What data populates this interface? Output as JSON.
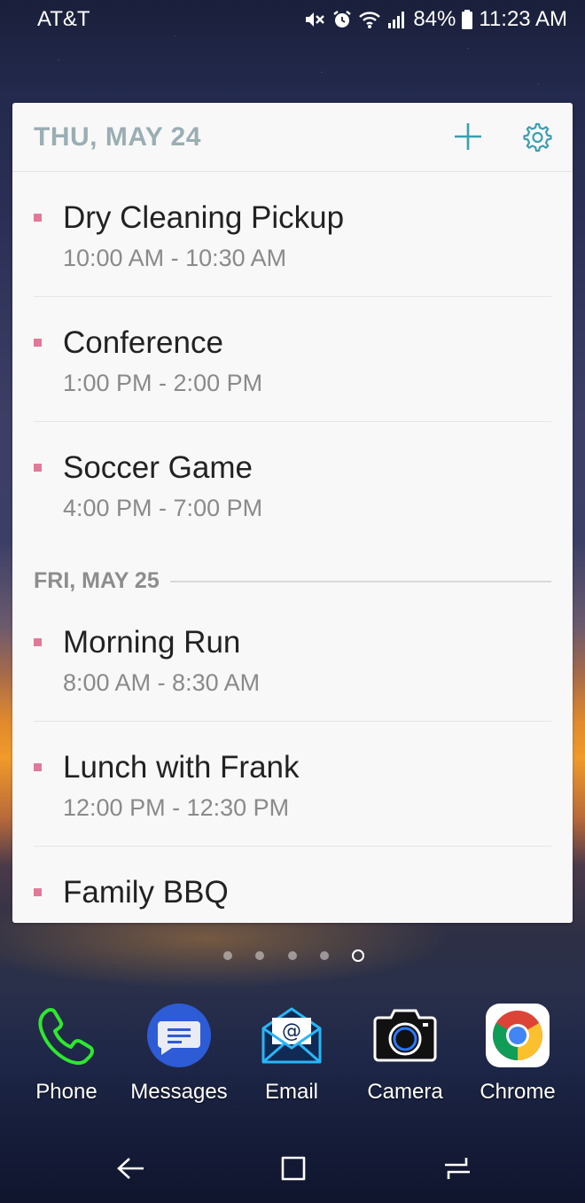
{
  "status_bar": {
    "carrier": "AT&T",
    "battery": "84%",
    "time": "11:23 AM"
  },
  "widget": {
    "header_date": "THU, MAY 24",
    "day2_label": "FRI, MAY 25",
    "accent_color": "#e07a98",
    "events_day1": [
      {
        "title": "Dry Cleaning Pickup",
        "time": "10:00 AM - 10:30 AM"
      },
      {
        "title": "Conference",
        "time": "1:00 PM - 2:00 PM"
      },
      {
        "title": "Soccer Game",
        "time": "4:00 PM - 7:00 PM"
      }
    ],
    "events_day2": [
      {
        "title": "Morning Run",
        "time": "8:00 AM - 8:30 AM"
      },
      {
        "title": "Lunch with Frank",
        "time": "12:00 PM - 12:30 PM"
      },
      {
        "title": "Family BBQ",
        "time": ""
      }
    ]
  },
  "page_indicator": {
    "count": 5,
    "active_index": 4
  },
  "dock": [
    {
      "label": "Phone",
      "icon": "phone-icon"
    },
    {
      "label": "Messages",
      "icon": "messages-icon"
    },
    {
      "label": "Email",
      "icon": "email-icon"
    },
    {
      "label": "Camera",
      "icon": "camera-icon"
    },
    {
      "label": "Chrome",
      "icon": "chrome-icon"
    }
  ],
  "navigation": [
    "back-icon",
    "home-icon",
    "recents-icon"
  ]
}
